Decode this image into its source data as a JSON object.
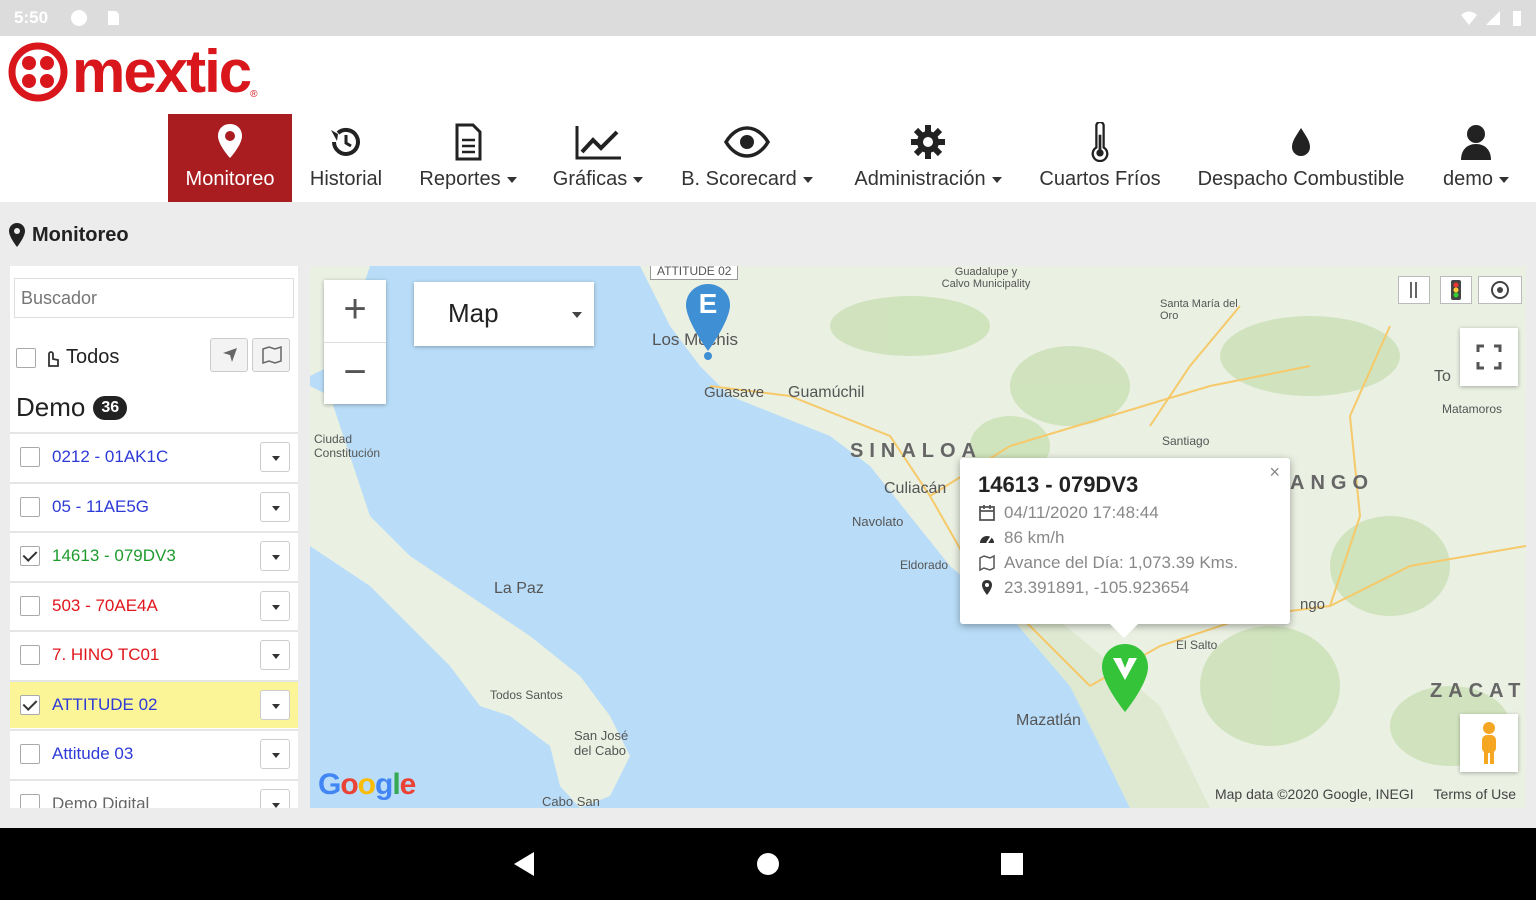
{
  "status_bar": {
    "time": "5:50"
  },
  "brand": {
    "name": "mextic",
    "color": "#d8161c"
  },
  "nav": {
    "items": [
      {
        "label": "Monitoreo",
        "icon": "map-pin-icon",
        "active": true
      },
      {
        "label": "Historial",
        "icon": "history-icon"
      },
      {
        "label": "Reportes",
        "icon": "document-icon",
        "dropdown": true
      },
      {
        "label": "Gráficas",
        "icon": "chart-line-icon",
        "dropdown": true
      },
      {
        "label": "B. Scorecard",
        "icon": "eye-icon",
        "dropdown": true
      },
      {
        "label": "Administración",
        "icon": "gear-icon",
        "dropdown": true
      },
      {
        "label": "Cuartos Fríos",
        "icon": "thermometer-icon"
      },
      {
        "label": "Despacho Combustible",
        "icon": "fuel-drop-icon"
      },
      {
        "label": "demo",
        "icon": "user-icon",
        "dropdown": true
      }
    ],
    "active_color": "#a91c20"
  },
  "breadcrumb": {
    "label": "Monitoreo"
  },
  "sidebar": {
    "search_placeholder": "Buscador",
    "todos_label": "Todos",
    "group": {
      "name": "Demo",
      "count": "36"
    },
    "vehicles": [
      {
        "label": "0212 - 01AK1C",
        "color": "#2d3ad6",
        "checked": false,
        "highlight": false
      },
      {
        "label": "05 - 11AE5G",
        "color": "#2d3ad6",
        "checked": false,
        "highlight": false
      },
      {
        "label": "14613 - 079DV3",
        "color": "#1e9b2e",
        "checked": true,
        "highlight": false
      },
      {
        "label": "503 - 70AE4A",
        "color": "#e0161c",
        "checked": false,
        "highlight": false
      },
      {
        "label": "7. HINO TC01",
        "color": "#e0161c",
        "checked": false,
        "highlight": false
      },
      {
        "label": "ATTITUDE 02",
        "color": "#2d3ad6",
        "checked": true,
        "highlight": true
      },
      {
        "label": "Attitude 03",
        "color": "#2d3ad6",
        "checked": false,
        "highlight": false
      },
      {
        "label": "Demo Digital",
        "color": "#666666",
        "checked": false,
        "highlight": false
      }
    ]
  },
  "map": {
    "type_selector": "Map",
    "zoom_in": "+",
    "zoom_out": "−",
    "labels": {
      "los_mochis": "Los Mochis",
      "guasave": "Guasave",
      "guamuchil": "Guamúchil",
      "sinaloa": "SINALOA",
      "culiacan": "Culiacán",
      "navolato": "Navolato",
      "eldorado": "Eldorado",
      "la_paz": "La Paz",
      "todos_santos": "Todos Santos",
      "san_jose": "San José del Cabo",
      "cabo_san": "Cabo San",
      "mazatlan": "Mazatlán",
      "durango": "ANGO",
      "zacat": "ZACAT",
      "santiago": "Santiago",
      "el_salto": "El Salto",
      "ciudad": "Ciudad Constitución",
      "santa_maria": "Santa María del Oro",
      "matamoros": "Matamoros",
      "guadalupe": "Guadalupe y Calvo Municipality",
      "attitude_marker": "ATTITUDE 02",
      "durango_city": "ngo",
      "to": "To"
    },
    "marker_e_letter": "E",
    "google": "Google",
    "attribution": "Map data ©2020 Google, INEGI",
    "terms": "Terms of Use",
    "popup": {
      "title": "14613 - 079DV3",
      "datetime": "04/11/2020 17:48:44",
      "speed": "86 km/h",
      "advance": "Avance del Día: 1,073.39 Kms.",
      "coords": "23.391891, -105.923654",
      "close": "×"
    }
  }
}
